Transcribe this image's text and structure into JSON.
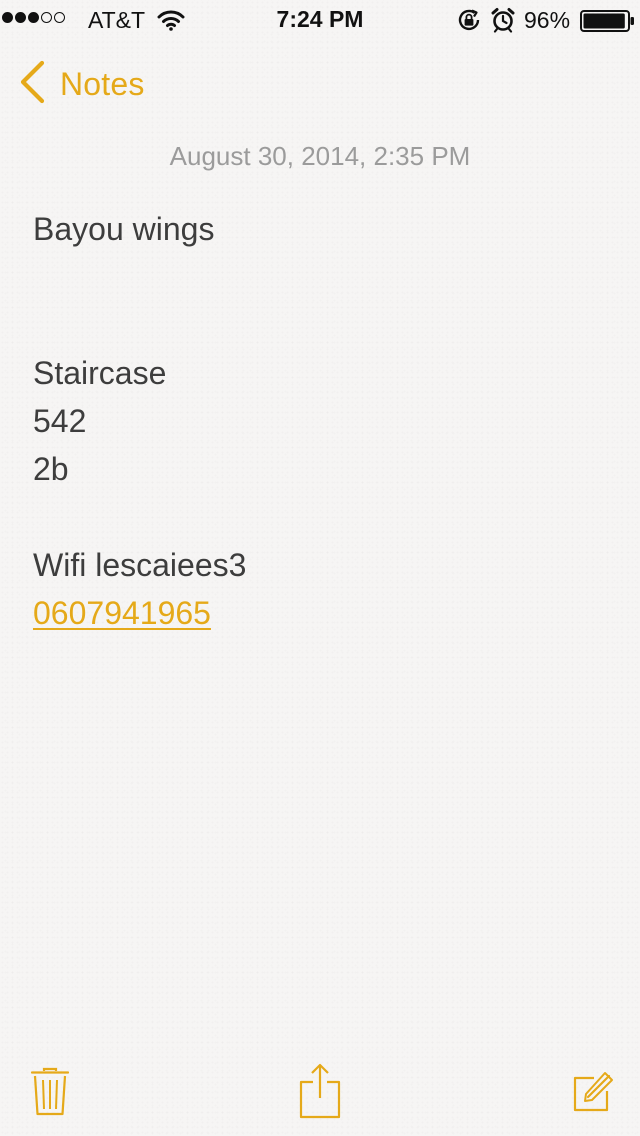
{
  "status_bar": {
    "signal_bars": 3,
    "signal_total": 5,
    "carrier": "AT&T",
    "time": "7:24 PM",
    "battery_percent": "96%",
    "battery_level": 0.96,
    "icons": [
      "wifi-icon",
      "rotation-lock-icon",
      "alarm-icon",
      "battery-icon"
    ]
  },
  "nav": {
    "back_label": "Notes",
    "back_icon": "chevron-left-icon"
  },
  "note": {
    "date": "August 30, 2014, 2:35 PM",
    "lines": [
      {
        "text": "Bayou wings",
        "type": "text"
      },
      {
        "text": "",
        "type": "blank"
      },
      {
        "text": "",
        "type": "blank"
      },
      {
        "text": "Staircase",
        "type": "text"
      },
      {
        "text": "542",
        "type": "text"
      },
      {
        "text": "2b",
        "type": "text"
      },
      {
        "text": "",
        "type": "blank"
      },
      {
        "text": "Wifi lescaiees3",
        "type": "text"
      },
      {
        "text": "0607941965",
        "type": "link"
      }
    ]
  },
  "toolbar": {
    "items": [
      "trash-icon",
      "share-icon",
      "compose-icon"
    ]
  },
  "colors": {
    "accent": "#e5a919",
    "background": "#f6f5f4",
    "date_text": "#9b9b9b",
    "body_text": "#3d3d3d"
  }
}
